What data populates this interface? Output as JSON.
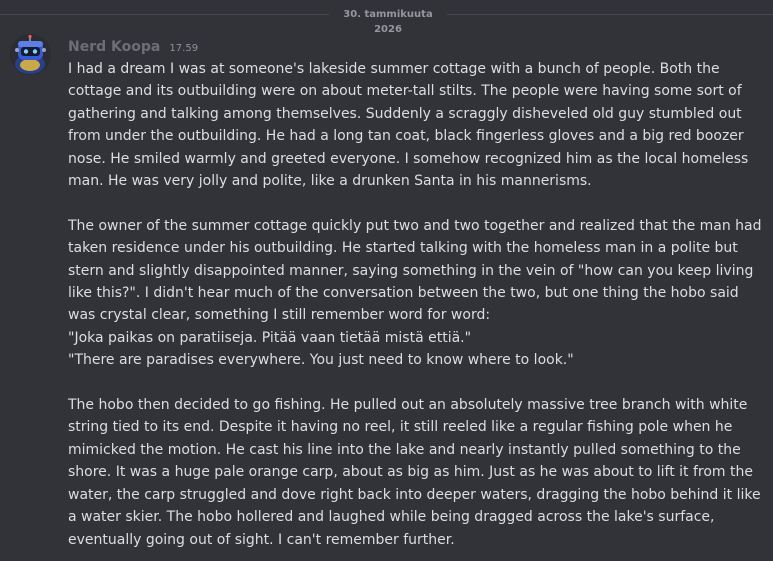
{
  "date_divider": "30. tammikuuta 2026",
  "message": {
    "username": "Nerd Koopa",
    "timestamp": "17.59",
    "avatar_icon": "koopa-robot-avatar-icon",
    "paragraphs": [
      "I had a dream I was at someone's lakeside summer cottage with a bunch of people. Both the cottage and its outbuilding were on about meter-tall stilts. The people were having some sort of gathering and talking among themselves. Suddenly a scraggly disheveled old guy stumbled out from under the outbuilding. He had a long tan coat, black fingerless gloves and a big red boozer nose. He smiled warmly and greeted everyone. I somehow recognized him as the local homeless man. He was very jolly and polite, like a drunken Santa in his mannerisms.",
      "The owner of the summer cottage quickly put two and two together and realized that the man had taken residence under his outbuilding. He started talking with the homeless man in a polite but stern and slightly disappointed manner, saying something in the vein of \"how can you keep living like this?\". I didn't hear much of the conversation between the two, but one thing the hobo said was crystal clear, something I still remember word for word:",
      "\"Joka paikas on paratiiseja. Pitää vaan tietää mistä ettiä.\"",
      "\"There are paradises everywhere. You just need to know where to look.\"",
      "The hobo then decided to go fishing. He pulled out an absolutely massive tree branch with white string tied to its end. Despite it having no reel, it still reeled like a regular fishing pole when he mimicked the motion. He cast his line into the lake and nearly instantly pulled something to the shore. It was a huge pale orange carp, about as big as him. Just as he was about to lift it from the water, the carp struggled and dove right back into deeper waters, dragging the hobo behind it like a water skier. The hobo hollered and laughed while being dragged across the lake's surface, eventually going out of sight. I can't remember further."
    ]
  },
  "colors": {
    "background": "#323339",
    "username": "#6d6f78",
    "text": "#dbdee1",
    "muted": "#94979e"
  }
}
